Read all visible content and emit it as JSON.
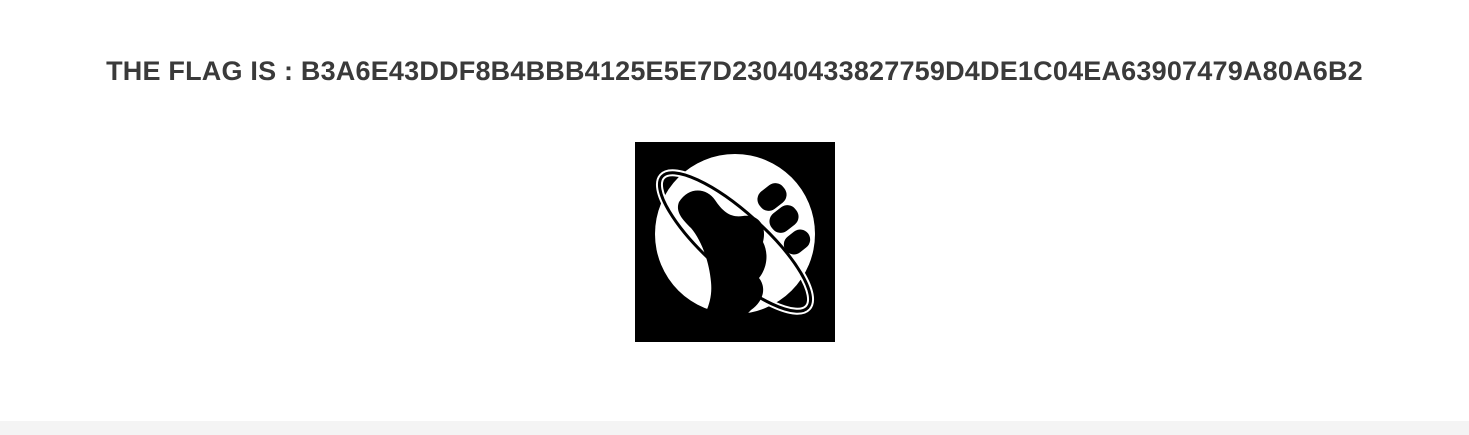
{
  "page": {
    "flag_text": "THE FLAG IS : B3A6E43DDF8B4BBB4125E5E7D23040433827759D4DE1C04EA63907479A80A6B2",
    "logo_icon": "thumbs-up-planet-icon",
    "text_color": "#3a3a3a",
    "footer_color": "#f4f4f4"
  }
}
